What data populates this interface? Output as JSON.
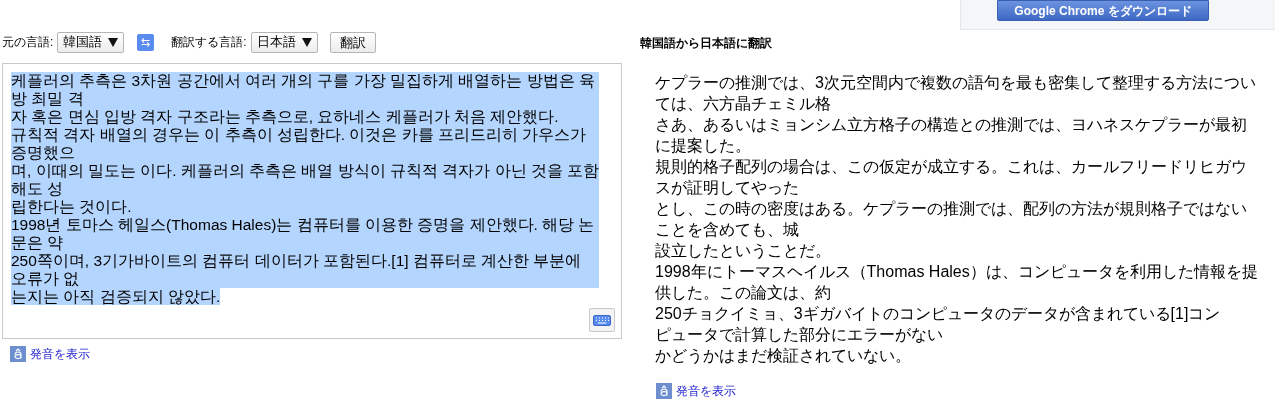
{
  "promo_button": {
    "label": "Google Chrome をダウンロード"
  },
  "toolbar": {
    "source_label": "元の言語:",
    "source_language": "韓国語",
    "swap_button": "⇆",
    "target_label": "翻訳する言語:",
    "target_language": "日本語",
    "translate_button": "翻訳"
  },
  "source": {
    "selected": true,
    "lines": [
      "케플러의 추측은 3차원 공간에서 여러 개의 구를 가장 밀집하게 배열하는 방법은 육",
      "방 최밀 격",
      "자 혹은 면심 입방 격자 구조라는 추측으로, 요하네스 케플러가 처음 제안했다.",
      "규칙적 격자 배열의 경우는 이 추측이 성립한다. 이것은 카를 프리드리히 가우스가",
      "증명했으",
      "며, 이때의 밀도는 이다. 케플러의 추측은 배열 방식이 규칙적 격자가 아닌 것을 포함",
      "해도 성",
      "립한다는 것이다.",
      "1998년 토마스 헤일스(Thomas Hales)는 컴퓨터를 이용한 증명을 제안했다. 해당 논",
      "문은 약",
      "250쪽이며, 3기가바이트의 컴퓨터 데이터가 포함된다.[1] 컴퓨터로 계산한 부분에",
      "오류가 없",
      "는지는 아직 검증되지 않았다."
    ],
    "pronunciation_link": "発音を表示"
  },
  "result": {
    "heading": "韓国語から日本語に翻訳",
    "lines": [
      "ケプラーの推測では、3次元空間内で複数の語句を最も密集して整理する方法につい",
      "ては、六方晶チェミル格",
      "さあ、あるいはミョンシム立方格子の構造との推測では、ヨハネスケプラーが最初",
      "に提案した。",
      "規則的格子配列の場合は、この仮定が成立する。これは、カールフリードリヒガウ",
      "スが証明してやった",
      "とし、この時の密度はある。ケプラーの推測では、配列の方法が規則格子ではない",
      "ことを含めても、城",
      "設立したということだ。",
      "1998年にトーマスヘイルス（Thomas Hales）は、コンピュータを利用した情報を提",
      "供した。この論文は、約",
      "250チョクイミョ、3ギガバイトのコンピュータのデータが含まれている[1]コン",
      "ピュータで計算した部分にエラーがない",
      "かどうかはまだ検証されていない。"
    ],
    "pronunciation_link": "発音を表示"
  }
}
